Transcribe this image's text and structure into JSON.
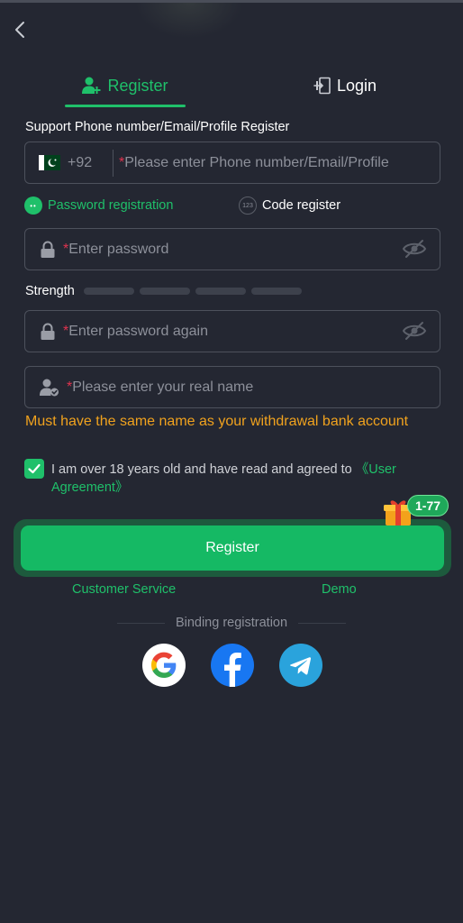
{
  "tabs": {
    "register": "Register",
    "login": "Login"
  },
  "form": {
    "support_label": "Support Phone number/Email/Profile Register",
    "country_code": "+92",
    "phone_placeholder": "Please enter Phone number/Email/Profile",
    "radio_password": "Password registration",
    "radio_code": "Code register",
    "password_placeholder": "Enter password",
    "strength_label": "Strength",
    "password_again_placeholder": "Enter password again",
    "real_name_placeholder": "Please enter your real name",
    "warning": "Must have the same name as your withdrawal bank account",
    "required_mark": "*"
  },
  "agreement": {
    "text": "I am over 18 years old and have read and agreed to ",
    "link": "《User Agreement》",
    "checked": true
  },
  "register_button": "Register",
  "gift_badge": "1-77",
  "links": {
    "customer_service": "Customer Service",
    "demo": "Demo"
  },
  "binding": {
    "label": "Binding registration",
    "providers": [
      "google",
      "facebook",
      "telegram"
    ]
  },
  "colors": {
    "accent": "#1fc06a",
    "warning": "#f0a21e",
    "background": "#242732",
    "required": "#e0334f"
  }
}
